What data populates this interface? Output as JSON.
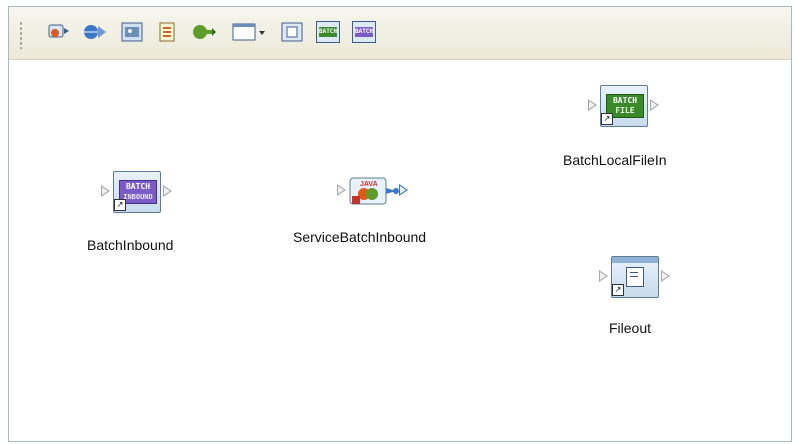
{
  "toolbar": {
    "items": [
      {
        "icon": "add-service-icon"
      },
      {
        "icon": "add-webservice-icon"
      },
      {
        "icon": "add-image-icon"
      },
      {
        "icon": "add-document-icon"
      },
      {
        "icon": "add-connector-icon"
      },
      {
        "icon": "layout-dropdown-icon"
      },
      {
        "icon": "file-icon"
      },
      {
        "icon": "batch-icon"
      },
      {
        "icon": "batch-inbound-icon"
      }
    ],
    "batch_label": "BATCH"
  },
  "canvas": {
    "nodes": [
      {
        "label": "BatchLocalFileIn",
        "icon": "batch-file-icon",
        "icon_text_top": "BATCH",
        "icon_text_bottom": "FILE"
      },
      {
        "label": "BatchInbound",
        "icon": "batch-inbound-icon",
        "icon_text_top": "BATCH",
        "icon_text_bottom": "INBOUND"
      },
      {
        "label": "ServiceBatchInbound",
        "icon": "java-service-icon",
        "icon_text_top": "JAVA"
      },
      {
        "label": "Fileout",
        "icon": "file-out-icon"
      }
    ]
  },
  "colors": {
    "toolbar_bg": "#ece9d8",
    "window_border": "#a9b6c6",
    "batch_green": "#3b8a2a",
    "batch_purple": "#7b5cc7"
  }
}
